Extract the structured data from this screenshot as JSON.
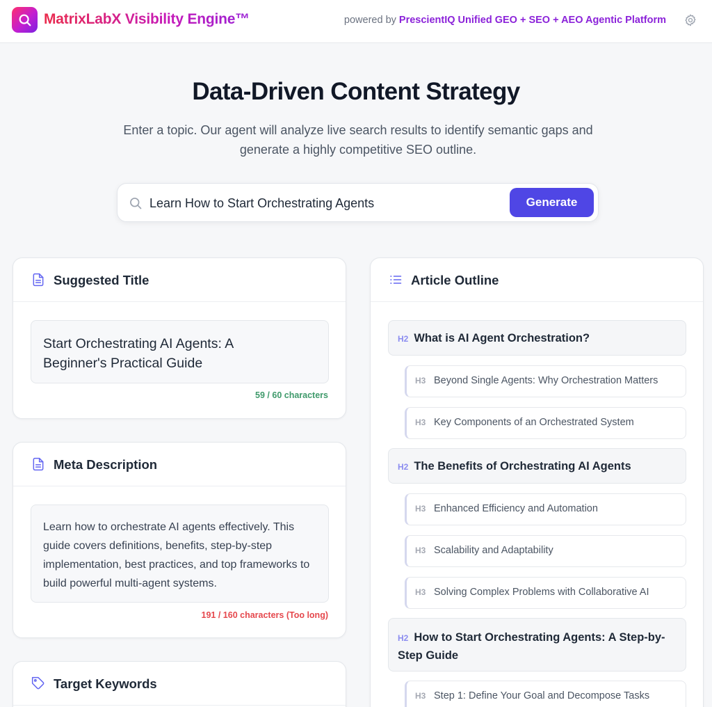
{
  "header": {
    "brand": "MatrixLabX Visibility Engine™",
    "powered_prefix": "powered by",
    "powered_platform": "PrescientIQ Unified GEO + SEO + AEO Agentic Platform"
  },
  "hero": {
    "title": "Data-Driven Content Strategy",
    "subtitle": "Enter a topic. Our agent will analyze live search results to identify semantic gaps and generate a highly competitive SEO outline."
  },
  "search": {
    "value": "Learn How to Start Orchestrating Agents",
    "button": "Generate"
  },
  "suggested_title": {
    "heading": "Suggested Title",
    "text": "Start Orchestrating AI Agents: A Beginner's Practical Guide",
    "count": "59 / 60 characters",
    "count_color": "#3f9a6b"
  },
  "meta_description": {
    "heading": "Meta Description",
    "text": "Learn how to orchestrate AI agents effectively. This guide covers definitions, benefits, step-by-step implementation, best practices, and top frameworks to build powerful multi-agent systems.",
    "count": "191 / 160 characters (Too long)",
    "count_color": "#e5484d"
  },
  "target_keywords": {
    "heading": "Target Keywords"
  },
  "outline": {
    "heading": "Article Outline",
    "h2_tag": "H2",
    "h3_tag": "H3",
    "sections": [
      {
        "h2": "What is AI Agent Orchestration?",
        "h3": [
          "Beyond Single Agents: Why Orchestration Matters",
          "Key Components of an Orchestrated System"
        ]
      },
      {
        "h2": "The Benefits of Orchestrating AI Agents",
        "h3": [
          "Enhanced Efficiency and Automation",
          "Scalability and Adaptability",
          "Solving Complex Problems with Collaborative AI"
        ]
      },
      {
        "h2": "How to Start Orchestrating Agents: A Step-by-Step Guide",
        "h3": [
          "Step 1: Define Your Goal and Decompose Tasks"
        ]
      }
    ]
  },
  "colors": {
    "accent": "#4f46e5",
    "brand_start": "#ea2b4c",
    "brand_end": "#9a22d6",
    "platform": "#8b22d9"
  },
  "icons": [
    "search-icon",
    "gear-icon",
    "document-icon",
    "list-icon",
    "tag-icon"
  ]
}
